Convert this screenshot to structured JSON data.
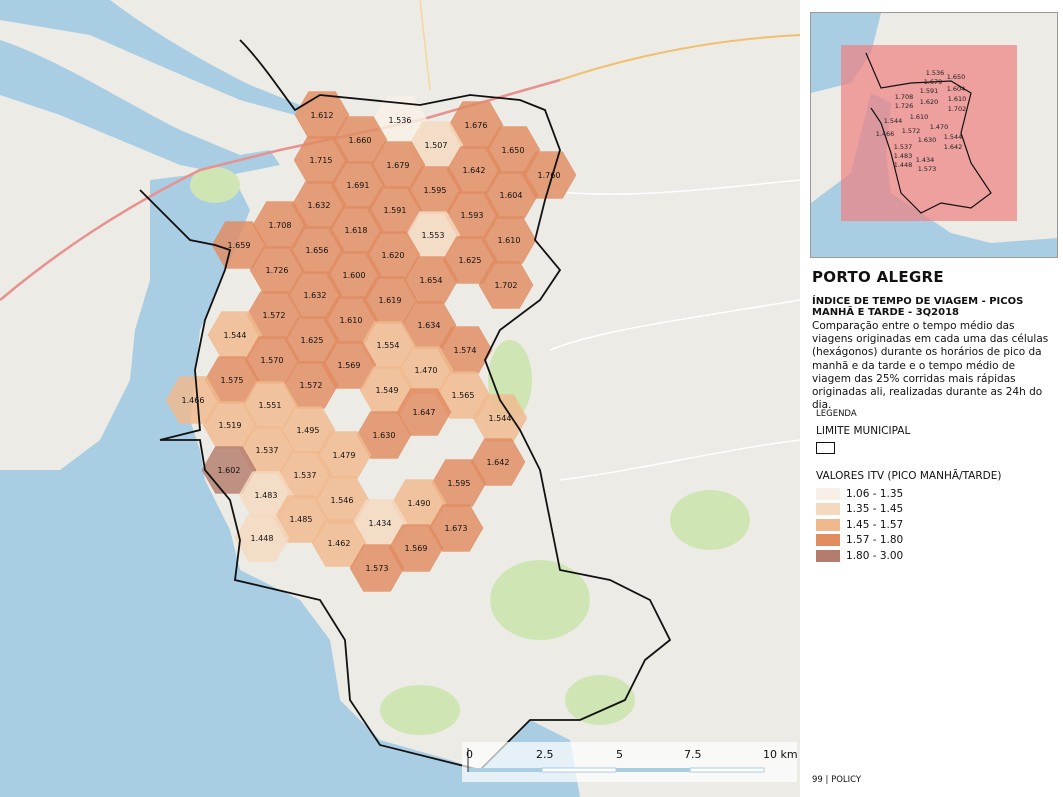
{
  "title": "PORTO ALEGRE",
  "subtitle": "ÍNDICE DE TEMPO DE VIAGEM - PICOS MANHÃ E TARDE - 3Q2018",
  "description": "Comparação entre o tempo médio das viagens originadas em cada uma das células (hexágonos) durante os horários de pico da manhã e da tarde e o tempo médio de viagem das 25% corridas mais rápidas originadas ali, realizadas durante as 24h do dia.",
  "legend": {
    "heading": "LEGENDA",
    "boundary_label": "LIMITE MUNICIPAL",
    "values_title": "VALORES ITV (PICO MANHÃ/TARDE)",
    "classes": [
      {
        "label": "1.06 - 1.35",
        "color": "#f8f0e6"
      },
      {
        "label": "1.35 - 1.45",
        "color": "#f5d9bf"
      },
      {
        "label": "1.45 - 1.57",
        "color": "#f0b98d"
      },
      {
        "label": "1.57 - 1.80",
        "color": "#e08b60"
      },
      {
        "label": "1.80 - 3.00",
        "color": "#b37c6c"
      }
    ]
  },
  "scale_bar": {
    "ticks": [
      "0",
      "2.5",
      "5",
      "7.5",
      "10 km"
    ]
  },
  "footer": "99 | POLICY",
  "colors": {
    "water": "#a9cde3",
    "land": "#ecebe6",
    "park": "#cfe6b4",
    "inset_overlay": "#f08080"
  },
  "hex_values": [
    {
      "v": "1.612",
      "c": 4
    },
    {
      "v": "1.536",
      "c": 1
    },
    {
      "v": "1.676",
      "c": 4
    },
    {
      "v": "1.660",
      "c": 4
    },
    {
      "v": "1.507",
      "c": 2
    },
    {
      "v": "1.650",
      "c": 4
    },
    {
      "v": "1.715",
      "c": 4
    },
    {
      "v": "1.679",
      "c": 4
    },
    {
      "v": "1.642",
      "c": 4
    },
    {
      "v": "1.760",
      "c": 4
    },
    {
      "v": "1.691",
      "c": 4
    },
    {
      "v": "1.595",
      "c": 4
    },
    {
      "v": "1.604",
      "c": 4
    },
    {
      "v": "1.708",
      "c": 4
    },
    {
      "v": "1.632",
      "c": 4
    },
    {
      "v": "1.591",
      "c": 4
    },
    {
      "v": "1.593",
      "c": 4
    },
    {
      "v": "1.618",
      "c": 4
    },
    {
      "v": "1.553",
      "c": 2
    },
    {
      "v": "1.610",
      "c": 4
    },
    {
      "v": "1.659",
      "c": 4
    },
    {
      "v": "1.656",
      "c": 4
    },
    {
      "v": "1.620",
      "c": 4
    },
    {
      "v": "1.625",
      "c": 4
    },
    {
      "v": "1.726",
      "c": 4
    },
    {
      "v": "1.600",
      "c": 4
    },
    {
      "v": "1.654",
      "c": 4
    },
    {
      "v": "1.702",
      "c": 4
    },
    {
      "v": "1.632",
      "c": 4
    },
    {
      "v": "1.619",
      "c": 4
    },
    {
      "v": "1.572",
      "c": 4
    },
    {
      "v": "1.610",
      "c": 4
    },
    {
      "v": "1.634",
      "c": 4
    },
    {
      "v": "1.544",
      "c": 3
    },
    {
      "v": "1.625",
      "c": 4
    },
    {
      "v": "1.554",
      "c": 3
    },
    {
      "v": "1.574",
      "c": 4
    },
    {
      "v": "1.570",
      "c": 4
    },
    {
      "v": "1.569",
      "c": 4
    },
    {
      "v": "1.470",
      "c": 3
    },
    {
      "v": "1.575",
      "c": 4
    },
    {
      "v": "1.572",
      "c": 4
    },
    {
      "v": "1.549",
      "c": 3
    },
    {
      "v": "1.565",
      "c": 3
    },
    {
      "v": "1.466",
      "c": 3
    },
    {
      "v": "1.551",
      "c": 3
    },
    {
      "v": "1.647",
      "c": 4
    },
    {
      "v": "1.544",
      "c": 3
    },
    {
      "v": "1.519",
      "c": 3
    },
    {
      "v": "1.495",
      "c": 3
    },
    {
      "v": "1.630",
      "c": 4
    },
    {
      "v": "1.537",
      "c": 3
    },
    {
      "v": "1.479",
      "c": 3
    },
    {
      "v": "1.642",
      "c": 4
    },
    {
      "v": "1.602",
      "c": 5
    },
    {
      "v": "1.537",
      "c": 3
    },
    {
      "v": "1.595",
      "c": 4
    },
    {
      "v": "1.483",
      "c": 2
    },
    {
      "v": "1.546",
      "c": 3
    },
    {
      "v": "1.490",
      "c": 3
    },
    {
      "v": "1.485",
      "c": 3
    },
    {
      "v": "1.434",
      "c": 2
    },
    {
      "v": "1.673",
      "c": 4
    },
    {
      "v": "1.448",
      "c": 2
    },
    {
      "v": "1.462",
      "c": 3
    },
    {
      "v": "1.569",
      "c": 4
    },
    {
      "v": "1.573",
      "c": 4
    }
  ],
  "inset_values": [
    "1.536",
    "1.679",
    "1.650",
    "1.604",
    "1.708",
    "1.591",
    "1.610",
    "1.726",
    "1.620",
    "1.702",
    "1.544",
    "1.610",
    "1.470",
    "1.466",
    "1.572",
    "1.537",
    "1.544",
    "1.630",
    "1.642",
    "1.483",
    "1.434",
    "1.448",
    "1.573"
  ]
}
